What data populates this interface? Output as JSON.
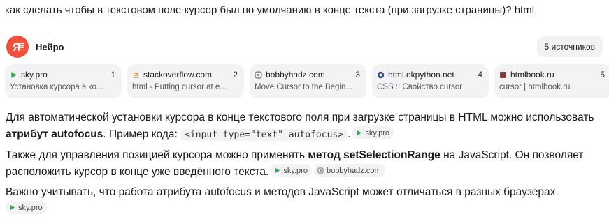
{
  "query": "как сделать чтобы в текстовом поле курсор был по умолчанию в конце текста (при загрузке страницы)? html",
  "brand": {
    "name": "Нейро",
    "logo_text": "Я"
  },
  "sources_button": "5 источников",
  "sources": [
    {
      "domain": "sky.pro",
      "number": "1",
      "description": "Установка курсора в ко...",
      "icon": "sky-pro-icon",
      "color": "#34a853"
    },
    {
      "domain": "stackoverflow.com",
      "number": "2",
      "description": "html - Putting cursor at e...",
      "icon": "stackoverflow-icon",
      "color": "#f48024"
    },
    {
      "domain": "bobbyhadz.com",
      "number": "3",
      "description": "Move Cursor to the Begin...",
      "icon": "bobbyhadz-icon",
      "color": "#888888"
    },
    {
      "domain": "html.okpython.net",
      "number": "4",
      "description": "CSS :: Свойство cursor",
      "icon": "okpython-icon",
      "color": "#2b4a8b"
    },
    {
      "domain": "htmlbook.ru",
      "number": "5",
      "description": "cursor | htmlbook.ru",
      "icon": "htmlbook-icon",
      "color": "#8b2b2b"
    }
  ],
  "answer": {
    "p1": {
      "text1": "Для автоматической установки курсора в конце текстового поля при загрузке страницы в HTML можно использовать ",
      "bold": "атрибут autofocus",
      "text2": ". Пример кода: ",
      "code": "<input type=\"text\" autofocus>",
      "text3": ".",
      "chips": [
        "sky.pro"
      ]
    },
    "p2": {
      "text1": "Также для управления позицией курсора можно применять ",
      "bold": "метод setSelectionRange",
      "text2": " на JavaScript. Он позволяет расположить курсор в конце уже введённого текста.",
      "chips": [
        "sky.pro",
        "bobbyhadz.com"
      ]
    },
    "p3": {
      "text1": "Важно учитывать, что работа атрибута autofocus и методов JavaScript может отличаться в разных браузерах.",
      "chips": [
        "sky.pro"
      ]
    }
  }
}
